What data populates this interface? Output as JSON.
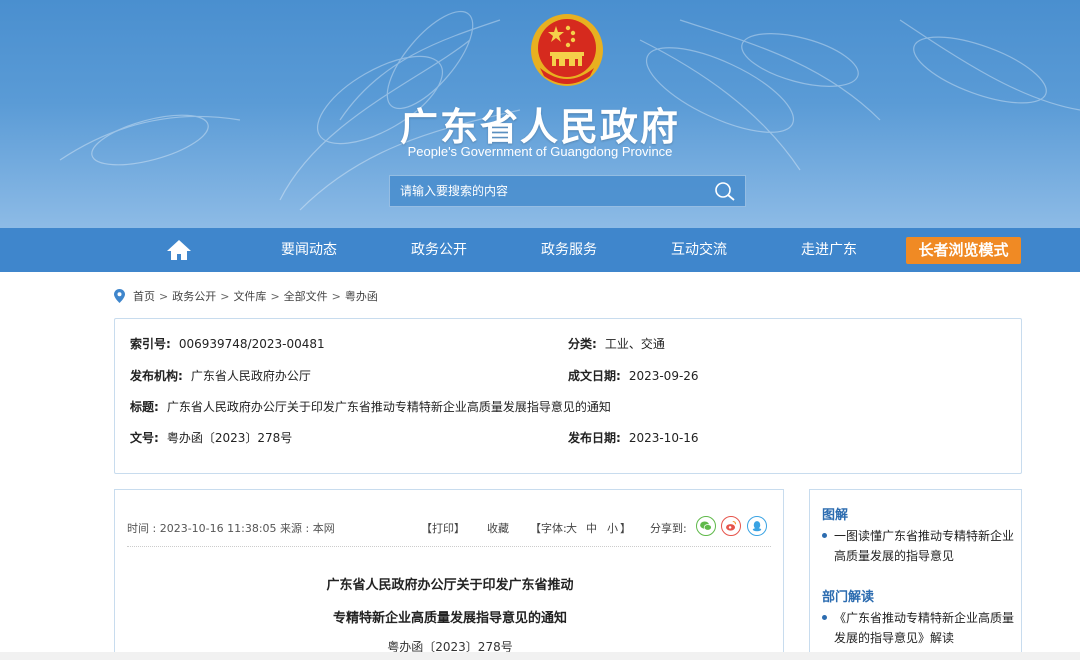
{
  "header": {
    "title": "广东省人民政府",
    "subtitle": "People's Government of Guangdong Province",
    "search_placeholder": "请输入要搜索的内容",
    "search_icon": "search-icon",
    "emblem_icon": "national-emblem-icon"
  },
  "nav": {
    "home_icon": "home-icon",
    "items": [
      "要闻动态",
      "政务公开",
      "政务服务",
      "互动交流",
      "走进广东"
    ],
    "elder_mode": "长者浏览模式"
  },
  "breadcrumb": {
    "icon": "location-pin-icon",
    "items": [
      "首页",
      "政务公开",
      "文件库",
      "全部文件",
      "粤办函"
    ],
    "separator": ">"
  },
  "info": {
    "index_no": {
      "label": "索引号:",
      "value": "006939748/2023-00481"
    },
    "category": {
      "label": "分类:",
      "value": "工业、交通"
    },
    "publisher": {
      "label": "发布机构:",
      "value": "广东省人民政府办公厅"
    },
    "written_date": {
      "label": "成文日期:",
      "value": "2023-09-26"
    },
    "title": {
      "label": "标题:",
      "value": "广东省人民政府办公厅关于印发广东省推动专精特新企业高质量发展指导意见的通知"
    },
    "doc_no": {
      "label": "文号:",
      "value": "粤办函〔2023〕278号"
    },
    "publish_date": {
      "label": "发布日期:",
      "value": "2023-10-16"
    }
  },
  "article": {
    "time": "时间 : 2023-10-16 11:38:05",
    "source": "来源 : 本网",
    "print": "【打印】",
    "favorite": "收藏",
    "font_open": "【字体:",
    "font_large": "大",
    "font_medium": "中",
    "font_small": "小",
    "font_close": "】",
    "share_label": "分享到:",
    "share_icons": [
      "wechat-icon",
      "weibo-icon",
      "qq-icon"
    ],
    "title_line1": "广东省人民政府办公厅关于印发广东省推动",
    "title_line2": "专精特新企业高质量发展指导意见的通知",
    "doc_no": "粤办函〔2023〕278号"
  },
  "sidebar": {
    "sections": [
      {
        "heading": "图解",
        "items": [
          "一图读懂广东省推动专精特新企业高质量发展的指导意见"
        ]
      },
      {
        "heading": "部门解读",
        "items": [
          "《广东省推动专精特新企业高质量发展的指导意见》解读"
        ]
      }
    ]
  },
  "colors": {
    "banner_top": "#4a8fcf",
    "nav_bg": "#3f86cc",
    "elder_btn": "#f08a24",
    "accent_text": "#2c6cb0",
    "border": "#c8dcee"
  }
}
